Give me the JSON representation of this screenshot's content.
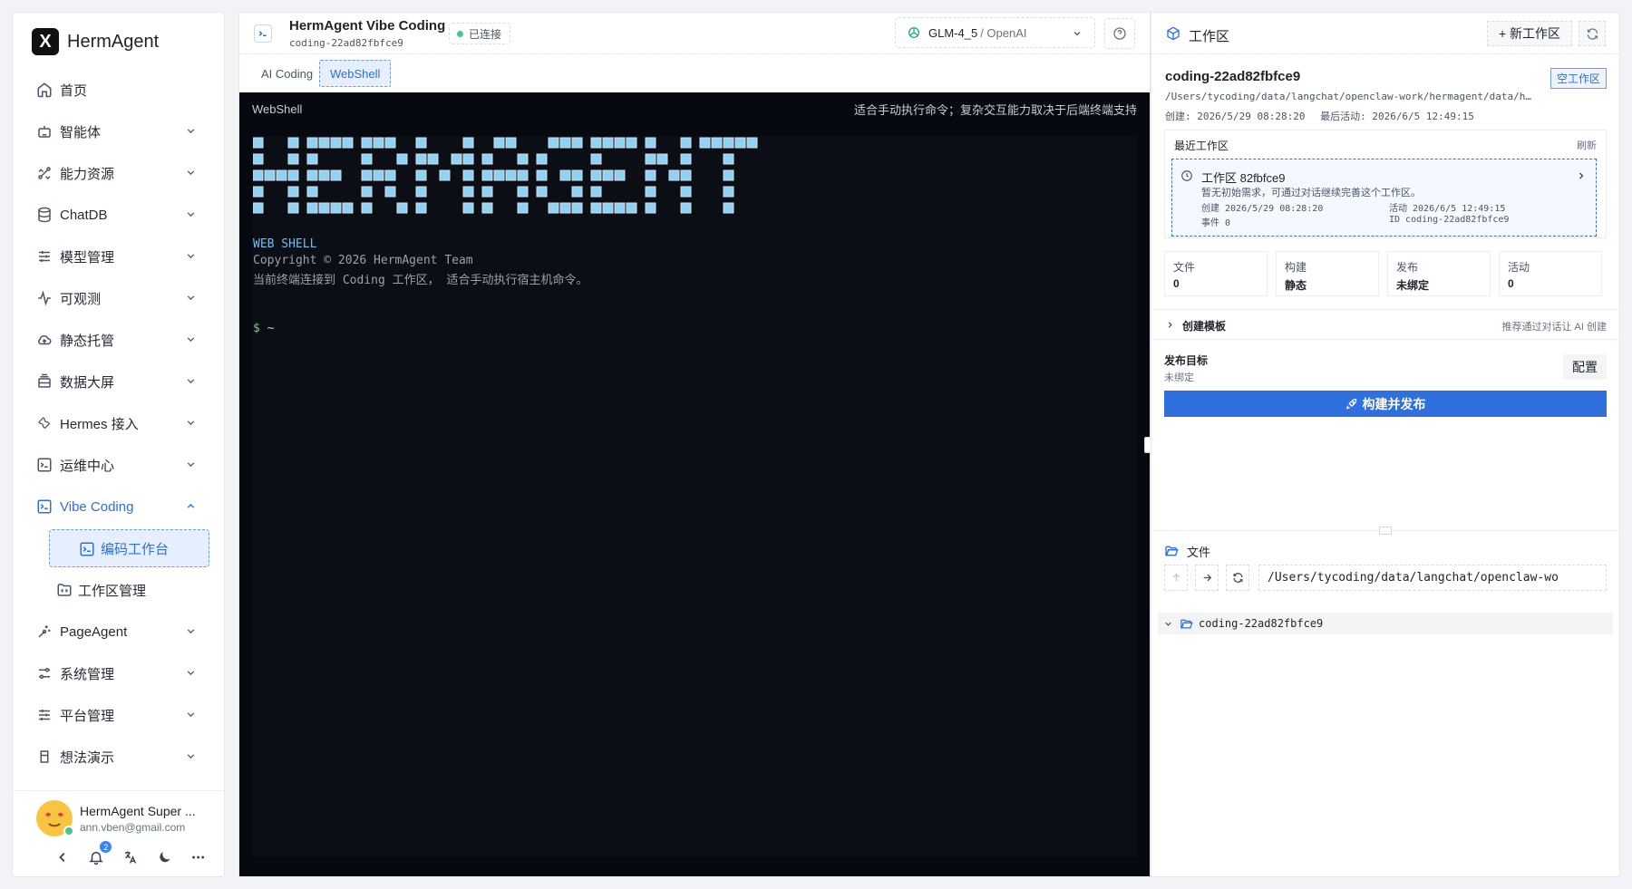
{
  "brand": {
    "logo": "X",
    "name": "HermAgent"
  },
  "sidebar": {
    "items": [
      {
        "label": "首页",
        "icon": "home-icon"
      },
      {
        "label": "智能体",
        "icon": "robot-icon"
      },
      {
        "label": "能力资源",
        "icon": "tools-icon"
      },
      {
        "label": "ChatDB",
        "icon": "database-icon"
      },
      {
        "label": "模型管理",
        "icon": "sliders-icon"
      },
      {
        "label": "可观测",
        "icon": "activity-icon"
      },
      {
        "label": "静态托管",
        "icon": "cloud-icon"
      },
      {
        "label": "数据大屏",
        "icon": "stack-icon"
      },
      {
        "label": "Hermes 接入",
        "icon": "wrench-icon"
      },
      {
        "label": "运维中心",
        "icon": "terminal-icon"
      },
      {
        "label": "Vibe Coding",
        "icon": "terminal-icon"
      }
    ],
    "sub_items": [
      {
        "label": "编码工作台",
        "icon": "terminal-icon"
      },
      {
        "label": "工作区管理",
        "icon": "folder-code-icon"
      }
    ],
    "bottom_items": [
      {
        "label": "PageAgent",
        "icon": "sparkle-icon"
      },
      {
        "label": "系统管理",
        "icon": "settings-icon"
      },
      {
        "label": "平台管理",
        "icon": "sliders-icon"
      },
      {
        "label": "想法演示",
        "icon": "bucket-icon"
      }
    ]
  },
  "user": {
    "name": "HermAgent Super ...",
    "email": "ann.vben@gmail.com",
    "notification_count": "2"
  },
  "header": {
    "title": "HermAgent Vibe Coding",
    "subtitle": "coding-22ad82fbfce9",
    "status": "已连接",
    "model_name": "GLM-4_5",
    "model_provider": "/ OpenAI"
  },
  "tabs": [
    {
      "label": "AI Coding"
    },
    {
      "label": "WebShell"
    }
  ],
  "terminal": {
    "header_left": "WebShell",
    "header_right": "适合手动执行命令；复杂交互能力取决于后端终端支持",
    "banner_text": "HERMAGENT",
    "line_web": "WEB SHELL",
    "line_copyright": "Copyright © 2026 HermAgent Team",
    "line_desc": "当前终端连接到 Coding 工作区， 适合手动执行宿主机命令。",
    "prompt_symbol": "$",
    "prompt_path": " ~"
  },
  "workspace": {
    "title": "工作区",
    "new_button": "+ 新工作区",
    "id": "coding-22ad82fbfce9",
    "empty_badge": "空工作区",
    "path": "/Users/tycoding/data/langchat/openclaw-work/hermagent/data/he...",
    "created": "创建: 2026/5/29 08:28:20",
    "last_active": "最后活动: 2026/6/5 12:49:15",
    "recent": {
      "title": "最近工作区",
      "refresh": "刷新",
      "card_title": "工作区 82fbfce9",
      "card_desc": "暂无初始需求，可通过对话继续完善这个工作区。",
      "created": "创建 2026/5/29 08:28:20",
      "active": "活动 2026/6/5 12:49:15",
      "events": "事件 0",
      "card_id": "ID coding-22ad82fbfce9"
    },
    "stats": [
      {
        "label": "文件",
        "value": "0"
      },
      {
        "label": "构建",
        "value": "静态"
      },
      {
        "label": "发布",
        "value": "未绑定"
      },
      {
        "label": "活动",
        "value": "0"
      }
    ],
    "template_label": "创建模板",
    "template_hint": "推荐通过对话让 AI 创建",
    "publish_label": "发布目标",
    "publish_value": "未绑定",
    "config_button": "配置",
    "build_button": "构建并发布"
  },
  "files": {
    "title": "文件",
    "path": "/Users/tycoding/data/langchat/openclaw-wo",
    "tree_root": "coding-22ad82fbfce9"
  },
  "colors": {
    "accent": "#2f6fde",
    "terminal_bg": "#060910",
    "ascii_fill": "#8dd3f5",
    "ascii_border": "#d7dde5",
    "status_ok": "#4cc38a"
  }
}
